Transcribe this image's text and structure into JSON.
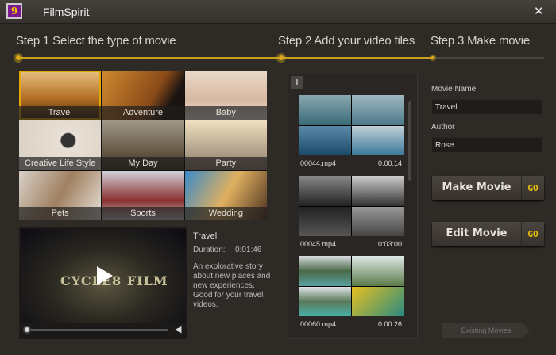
{
  "app": {
    "title": "FilmSpirit",
    "logo_text": "9",
    "close": "✕"
  },
  "steps": [
    "Step 1 Select the type of movie",
    "Step 2 Add your video files",
    "Step 3 Make movie"
  ],
  "progress_step": 3,
  "accent": "#d9a81c",
  "categories": [
    {
      "label": "Travel",
      "selected": true
    },
    {
      "label": "Adventure"
    },
    {
      "label": "Baby"
    },
    {
      "label": "Creative Life Style"
    },
    {
      "label": "My Day"
    },
    {
      "label": "Party"
    },
    {
      "label": "Pets"
    },
    {
      "label": "Sports"
    },
    {
      "label": "Wedding"
    }
  ],
  "preview": {
    "video_title": "CYCLE8 FILM",
    "name": "Travel",
    "duration_label": "Duration:",
    "duration": "0:01:46",
    "description": "An explorative story about new places and new experiences. Good for your travel videos."
  },
  "clips": [
    {
      "name": "00044.mp4",
      "duration": "0:00:14"
    },
    {
      "name": "00045.mp4",
      "duration": "0:03:00"
    },
    {
      "name": "00060.mp4",
      "duration": "0:00:26"
    }
  ],
  "add_label": "+",
  "form": {
    "movie_name_label": "Movie Name",
    "movie_name": "Travel",
    "author_label": "Author",
    "author": "Rose"
  },
  "buttons": {
    "make": "Make Movie",
    "edit": "Edit Movie",
    "go": "GO",
    "existing": "Existing Movies"
  }
}
